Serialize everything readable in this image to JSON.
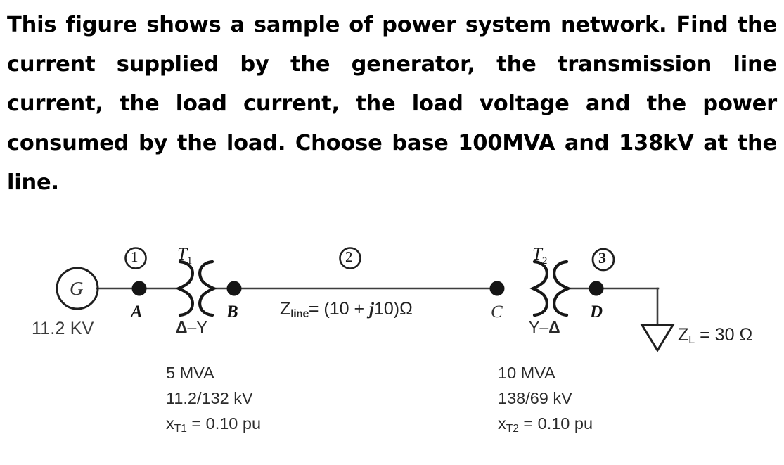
{
  "problem": {
    "text": "This figure shows a sample of power system network. Find the current supplied by the generator,  the transmission line current, the load current, the load voltage and the power consumed by the load. Choose base  100MVA and 138kV  at the line."
  },
  "diagram": {
    "title": "single-line power system diagram",
    "generator": {
      "symbol": "G",
      "voltage": "11.2 KV"
    },
    "buses": [
      {
        "number": "1"
      },
      {
        "number": "2"
      },
      {
        "number": "3"
      }
    ],
    "nodes": [
      {
        "label": "A"
      },
      {
        "label": "B"
      },
      {
        "label": "C"
      },
      {
        "label": "D"
      }
    ],
    "transformers": [
      {
        "name": "T",
        "index": "1",
        "connection": "Δ–Y",
        "connection_delta": "Δ",
        "connection_dash": "–",
        "connection_wye": "Y",
        "rating": "5 MVA",
        "ratio": "11.2/132 kV",
        "reactance_symbol": "x",
        "reactance_sub": "T1",
        "reactance_value": "= 0.10 pu"
      },
      {
        "name": "T",
        "index": "2",
        "connection": "Y–Δ",
        "connection_wye": "Y",
        "connection_dash": "–",
        "connection_delta": "Δ",
        "rating": "10 MVA",
        "ratio": "138/69 kV",
        "reactance_symbol": "x",
        "reactance_sub": "T2",
        "reactance_value": "= 0.10 pu"
      }
    ],
    "line": {
      "symbol": "Z",
      "subscript": "line",
      "value": "= (10 + j10)Ω",
      "value_prefix": "= (10 + ",
      "value_j": "j",
      "value_suffix": "10)Ω"
    },
    "load": {
      "symbol": "Z",
      "subscript": "L",
      "value": "= 30 Ω"
    }
  },
  "colors": {
    "ink": "#1a1a1a",
    "line": "#444444",
    "background": "#ffffff"
  }
}
